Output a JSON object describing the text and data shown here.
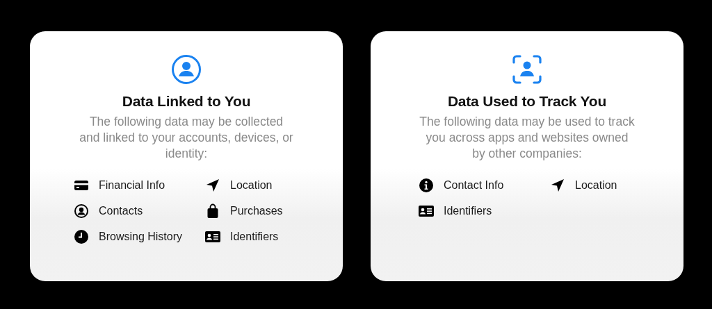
{
  "cards": [
    {
      "kind": "person-circle",
      "title": "Data Linked to You",
      "description": "The following data may be collected and linked to your accounts, devices, or identity:",
      "items": [
        {
          "kind": "card",
          "label": "Financial Info"
        },
        {
          "kind": "location",
          "label": "Location"
        },
        {
          "kind": "contacts",
          "label": "Contacts"
        },
        {
          "kind": "bag",
          "label": "Purchases"
        },
        {
          "kind": "clock",
          "label": "Browsing History"
        },
        {
          "kind": "id",
          "label": "Identifiers"
        }
      ]
    },
    {
      "kind": "person-frame",
      "title": "Data Used to Track You",
      "description": "The following data may be used to track you across apps and websites owned by other companies:",
      "items": [
        {
          "kind": "info",
          "label": "Contact Info"
        },
        {
          "kind": "location",
          "label": "Location"
        },
        {
          "kind": "id",
          "label": "Identifiers"
        }
      ]
    }
  ]
}
